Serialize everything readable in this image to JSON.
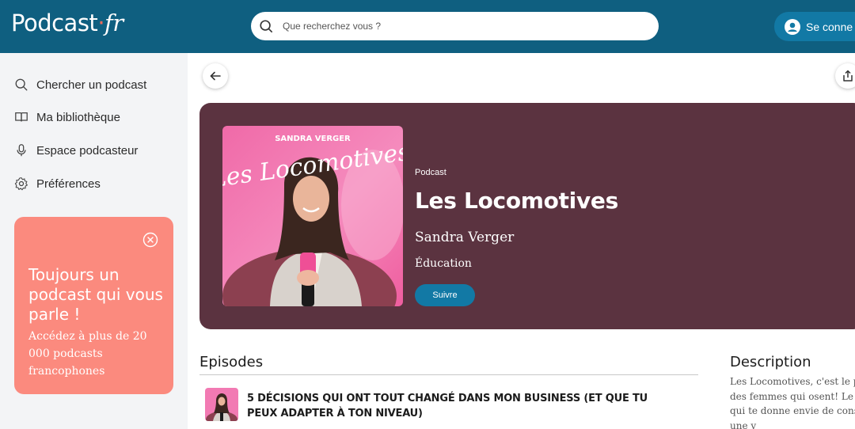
{
  "header": {
    "logo_main": "Podcast",
    "logo_dot": "·",
    "logo_suffix": "fr",
    "search_placeholder": "Que recherchez vous ?",
    "login_label": "Se conne"
  },
  "sidebar": {
    "items": [
      {
        "label": "Chercher un podcast",
        "icon": "search-icon"
      },
      {
        "label": "Ma bibliothèque",
        "icon": "library-icon"
      },
      {
        "label": "Espace podcasteur",
        "icon": "microphone-icon"
      },
      {
        "label": "Préférences",
        "icon": "gear-icon"
      }
    ],
    "promo": {
      "title": "Toujours un podcast qui vous parle !",
      "body": "Accédez à plus de 20 000 podcasts francophones"
    }
  },
  "podcast": {
    "kicker": "Podcast",
    "title": "Les Locomotives",
    "author": "Sandra Verger",
    "category": "Éducation",
    "follow_label": "Suivre",
    "cover": {
      "top_text": "SANDRA VERGER",
      "script_text": "Les Locomotives"
    }
  },
  "episodes": {
    "heading": "Episodes",
    "items": [
      {
        "title": "5 DÉCISIONS QUI ONT TOUT CHANGÉ DANS MON BUSINESS (ET QUE TU PEUX ADAPTER À TON NIVEAU)"
      }
    ]
  },
  "description": {
    "heading": "Description",
    "lines": [
      "Les Locomotives, c'est le p",
      "des femmes qui osent!  Le p",
      "qui te donne envie de cons",
      "une v"
    ]
  },
  "colors": {
    "header_bg": "#0f5f80",
    "accent_blue": "#1279a5",
    "hero_bg": "#5b3340",
    "promo_bg": "#fb8a7e",
    "sidebar_bg": "#f3f4f6"
  }
}
